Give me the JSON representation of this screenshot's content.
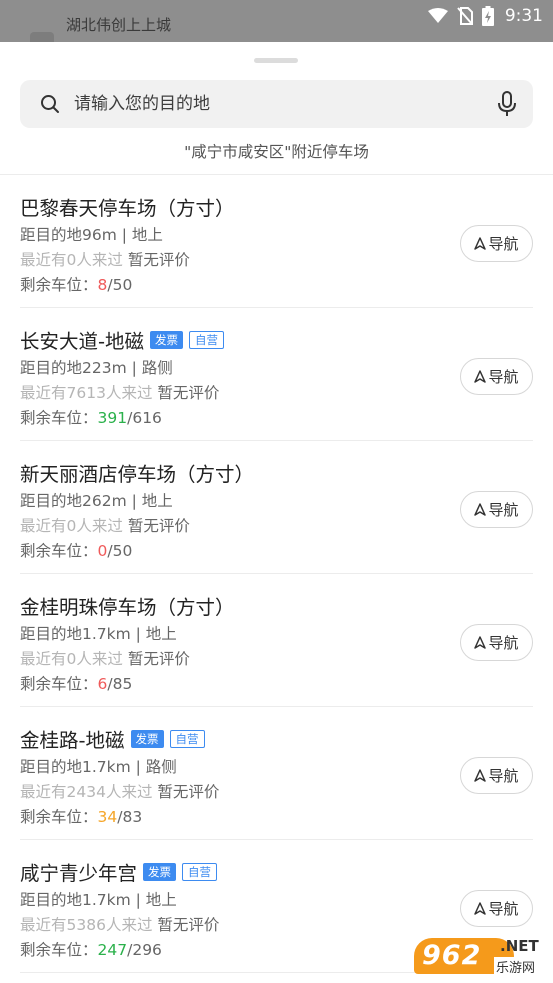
{
  "status_bar": {
    "background_title": "湖北伟创上上城",
    "time": "9:31"
  },
  "search": {
    "placeholder": "请输入您的目的地",
    "icon": "search-icon",
    "voice_icon": "microphone-icon"
  },
  "nearby_label": "\"咸宁市咸安区\"附近停车场",
  "labels": {
    "remaining": "剩余车位：",
    "navigate": "导航",
    "invoice_tag": "发票",
    "self_run_tag": "自营"
  },
  "parking_lots": [
    {
      "name": "巴黎春天停车场（方寸）",
      "invoice": false,
      "self_run": false,
      "distance_text": "距目的地96m | 地上",
      "visitors_text": "最近有0人来过",
      "rating_text": "暂无评价",
      "spots_free": "8",
      "spots_total": "/50",
      "free_color": "red"
    },
    {
      "name": "长安大道-地磁",
      "invoice": true,
      "self_run": true,
      "distance_text": "距目的地223m | 路侧",
      "visitors_text": "最近有7613人来过",
      "rating_text": "暂无评价",
      "spots_free": "391",
      "spots_total": "/616",
      "free_color": "green"
    },
    {
      "name": "新天丽酒店停车场（方寸）",
      "invoice": false,
      "self_run": false,
      "distance_text": "距目的地262m | 地上",
      "visitors_text": "最近有0人来过",
      "rating_text": "暂无评价",
      "spots_free": "0",
      "spots_total": "/50",
      "free_color": "red"
    },
    {
      "name": "金桂明珠停车场（方寸）",
      "invoice": false,
      "self_run": false,
      "distance_text": "距目的地1.7km | 地上",
      "visitors_text": "最近有0人来过",
      "rating_text": "暂无评价",
      "spots_free": "6",
      "spots_total": "/85",
      "free_color": "red"
    },
    {
      "name": "金桂路-地磁",
      "invoice": true,
      "self_run": true,
      "distance_text": "距目的地1.7km | 路侧",
      "visitors_text": "最近有2434人来过",
      "rating_text": "暂无评价",
      "spots_free": "34",
      "spots_total": "/83",
      "free_color": "orange"
    },
    {
      "name": "咸宁青少年宫",
      "invoice": true,
      "self_run": true,
      "distance_text": "距目的地1.7km | 地上",
      "visitors_text": "最近有5386人来过",
      "rating_text": "暂无评价",
      "spots_free": "247",
      "spots_total": "/296",
      "free_color": "green"
    }
  ],
  "watermark": {
    "number": "962",
    "suffix": ".NET",
    "sub": "乐游网"
  }
}
